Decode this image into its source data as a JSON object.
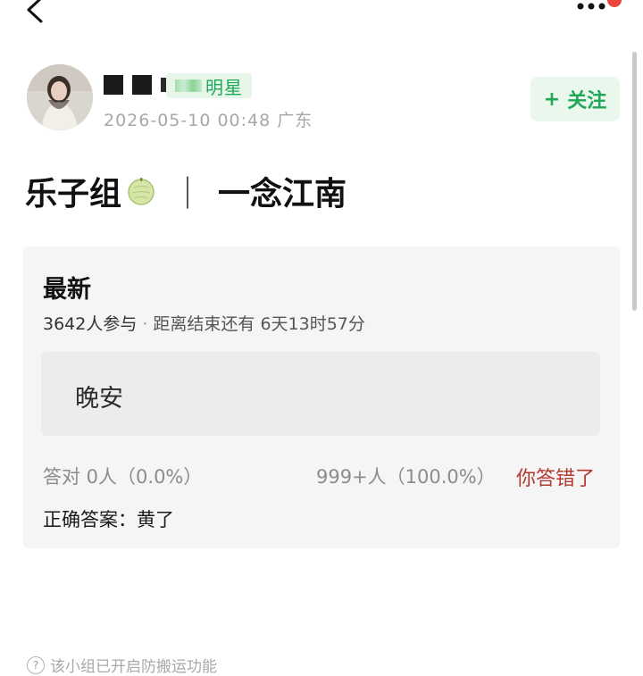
{
  "post": {
    "badge_label": "明星",
    "timestamp": "2026-05-10 00:48",
    "location": "广东",
    "follow_label": "关注",
    "follow_plus": "+",
    "title_prefix": "乐子组",
    "title_separator": "｜",
    "title_suffix": "一念江南"
  },
  "poll": {
    "heading": "最新",
    "participants": "3642人参与",
    "meta_separator": "·",
    "time_left": "距离结束还有 6天13时57分",
    "option_text": "晚安",
    "correct_stats": "答对  0人（0.0%）",
    "selected_stats": "999+人（100.0%）",
    "result_label": "你答错了",
    "answer_line": "正确答案：黄了"
  },
  "footer": {
    "note": "该小组已开启防搬运功能",
    "note_icon": "question-circle-icon"
  },
  "colors": {
    "accent_green": "#20a857",
    "wrong_red": "#b2392f",
    "card_bg": "#f5f5f5"
  },
  "icons": {
    "back": "chevron-left-icon",
    "more": "more-dots-icon",
    "title_emoji": "melon-icon"
  }
}
